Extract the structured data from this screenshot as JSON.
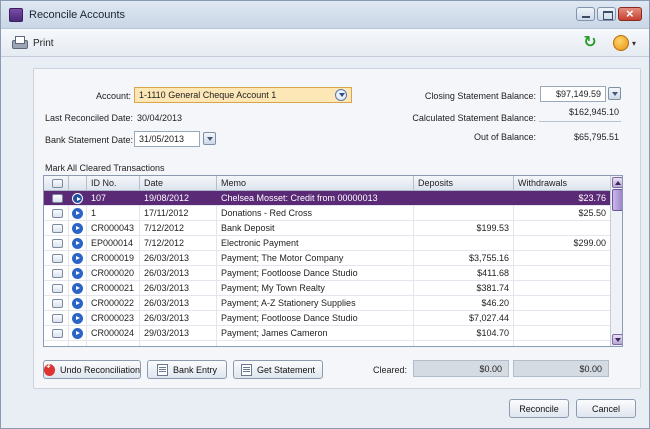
{
  "window": {
    "title": "Reconcile Accounts"
  },
  "toolbar": {
    "print_label": "Print"
  },
  "form": {
    "account_label": "Account:",
    "account_value": "1-1110 General Cheque Account 1",
    "last_reconciled_label": "Last Reconciled Date:",
    "last_reconciled_value": "30/04/2013",
    "bank_statement_label": "Bank Statement Date:",
    "bank_statement_value": "31/05/2013",
    "closing_label": "Closing Statement Balance:",
    "closing_value": "$97,149.59",
    "calculated_label": "Calculated Statement Balance:",
    "calculated_value": "$162,945.10",
    "out_of_balance_label": "Out of Balance:",
    "out_of_balance_value": "$65,795.51",
    "mark_all_label": "Mark All Cleared Transactions"
  },
  "table": {
    "columns": [
      "ID No.",
      "Date",
      "Memo",
      "Deposits",
      "Withdrawals"
    ],
    "rows": [
      {
        "id": "107",
        "date": "19/08/2012",
        "memo": "Chelsea Mosset: Credit from 00000013",
        "deposit": "",
        "withdrawal": "$23.76",
        "selected": true
      },
      {
        "id": "1",
        "date": "17/11/2012",
        "memo": "Donations - Red Cross",
        "deposit": "",
        "withdrawal": "$25.50"
      },
      {
        "id": "CR000043",
        "date": "7/12/2012",
        "memo": "Bank Deposit",
        "deposit": "$199.53",
        "withdrawal": ""
      },
      {
        "id": "EP000014",
        "date": "7/12/2012",
        "memo": "Electronic Payment",
        "deposit": "",
        "withdrawal": "$299.00"
      },
      {
        "id": "CR000019",
        "date": "26/03/2013",
        "memo": "Payment; The Motor Company",
        "deposit": "$3,755.16",
        "withdrawal": ""
      },
      {
        "id": "CR000020",
        "date": "26/03/2013",
        "memo": "Payment; Footloose Dance Studio",
        "deposit": "$411.68",
        "withdrawal": ""
      },
      {
        "id": "CR000021",
        "date": "26/03/2013",
        "memo": "Payment; My Town Realty",
        "deposit": "$381.74",
        "withdrawal": ""
      },
      {
        "id": "CR000022",
        "date": "26/03/2013",
        "memo": "Payment; A-Z Stationery Supplies",
        "deposit": "$46.20",
        "withdrawal": ""
      },
      {
        "id": "CR000023",
        "date": "26/03/2013",
        "memo": "Payment; Footloose Dance Studio",
        "deposit": "$7,027.44",
        "withdrawal": ""
      },
      {
        "id": "CR000024",
        "date": "29/03/2013",
        "memo": "Payment; James Cameron",
        "deposit": "$104.70",
        "withdrawal": ""
      }
    ]
  },
  "actions": {
    "undo_label": "Undo Reconciliation",
    "bank_entry_label": "Bank Entry",
    "get_statement_label": "Get Statement",
    "cleared_label": "Cleared:",
    "cleared_deposits": "$0.00",
    "cleared_withdrawals": "$0.00",
    "reconcile_label": "Reconcile",
    "cancel_label": "Cancel"
  },
  "colors": {
    "selected_row": "#5a2a76",
    "account_field": "#fde7b6"
  },
  "icons": [
    "app-icon",
    "print-icon",
    "refresh-icon",
    "help-icon",
    "dropdown-icon",
    "calendar-icon",
    "row-arrow-icon",
    "undo-icon",
    "document-icon"
  ]
}
